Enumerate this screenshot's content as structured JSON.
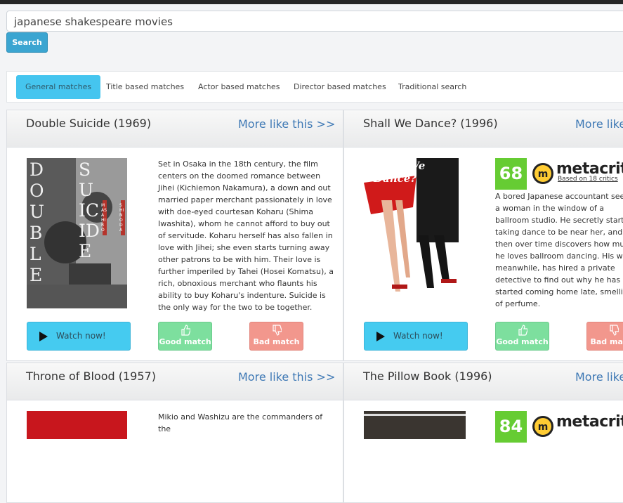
{
  "search": {
    "query": "japanese shakespeare movies",
    "button_label": "Search"
  },
  "tabs": [
    {
      "label": "General matches",
      "active": true
    },
    {
      "label": "Title based matches",
      "active": false
    },
    {
      "label": "Actor based matches",
      "active": false
    },
    {
      "label": "Director based matches",
      "active": false
    },
    {
      "label": "Traditional search",
      "active": false
    }
  ],
  "common": {
    "more_label": "More like this >>",
    "watch_label": "Watch now!",
    "good_label": "Good match",
    "bad_label": "Bad match"
  },
  "movies": [
    {
      "title": "Double Suicide (1969)",
      "poster": {
        "title_text_left": "DOUBLE",
        "title_text_right": "SUICIDE",
        "side_text_1": "MASAHIRO",
        "side_text_2": "SHINODA"
      },
      "description": "Set in Osaka in the 18th century, the film centers on the doomed romance between Jihei (Kichiemon Nakamura), a down and out married paper merchant passionately in love with doe-eyed courtesan Koharu (Shima Iwashita), whom he cannot afford to buy out of servitude. Koharu herself has also fallen in love with Jihei; she even starts turning away other patrons to be with him. Their love is further imperiled by Tahei (Hosei Komatsu), a rich, obnoxious merchant who flaunts his ability to buy Koharu's indenture. Suicide is the only way for the two to be together."
    },
    {
      "title": "Shall We Dance? (1996)",
      "poster": {
        "title_text": "Shall We Dance?"
      },
      "metascore": "68",
      "metacritic_name": "metacritic",
      "critics_text": "Based on 18 critics",
      "description": "A bored Japanese accountant sees a woman in the window of a ballroom studio. He secretly starts taking dance to be near her, and then over time discovers how much he loves ballroom dancing. His wife, meanwhile, has hired a private detective to find out why he has started coming home late, smelling of perfume."
    },
    {
      "title": "Throne of Blood (1957)",
      "description": "Mikio and Washizu are the commanders of the"
    },
    {
      "title": "The Pillow Book (1996)",
      "metascore": "84",
      "metacritic_name": "metacritic"
    }
  ],
  "colors": {
    "accent": "#45c5ef",
    "link": "#3f79b5",
    "good": "#7ddf9e",
    "bad": "#f2978d",
    "metascore": "#66cc33"
  }
}
